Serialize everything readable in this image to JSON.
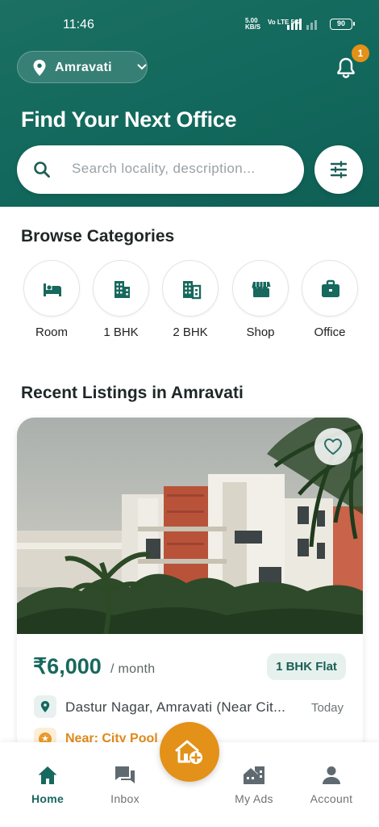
{
  "status_bar": {
    "time": "11:46",
    "network_speed": "5.00\nKB/S",
    "volte": "Vo LTE",
    "signal_type": "5G",
    "battery": "90"
  },
  "header": {
    "location": "Amravati",
    "notification_count": "1",
    "title": "Find Your Next Office",
    "search_placeholder": "Search locality, description..."
  },
  "categories": {
    "title": "Browse Categories",
    "items": [
      {
        "label": "Room",
        "icon": "bed-icon"
      },
      {
        "label": "1 BHK",
        "icon": "building-icon"
      },
      {
        "label": "2 BHK",
        "icon": "apartment-icon"
      },
      {
        "label": "Shop",
        "icon": "store-icon"
      },
      {
        "label": "Office",
        "icon": "briefcase-icon"
      }
    ]
  },
  "recent": {
    "title": "Recent Listings in Amravati",
    "listing": {
      "price": "₹6,000",
      "period": "/ month",
      "type": "1 BHK Flat",
      "address": "Dastur Nagar, Amravati (Near Cit...",
      "posted": "Today",
      "nearby": "Near: City Pool"
    }
  },
  "bottom_nav": {
    "items": [
      {
        "label": "Home",
        "icon": "home-icon",
        "active": true
      },
      {
        "label": "Inbox",
        "icon": "chat-icon",
        "active": false
      },
      {
        "label": "My Ads",
        "icon": "my-ads-icon",
        "active": false
      },
      {
        "label": "Account",
        "icon": "account-icon",
        "active": false
      }
    ],
    "post_ad_icon": "add-home-icon"
  },
  "colors": {
    "primary": "#17685d",
    "accent": "#e39118",
    "background": "#ffffff"
  }
}
